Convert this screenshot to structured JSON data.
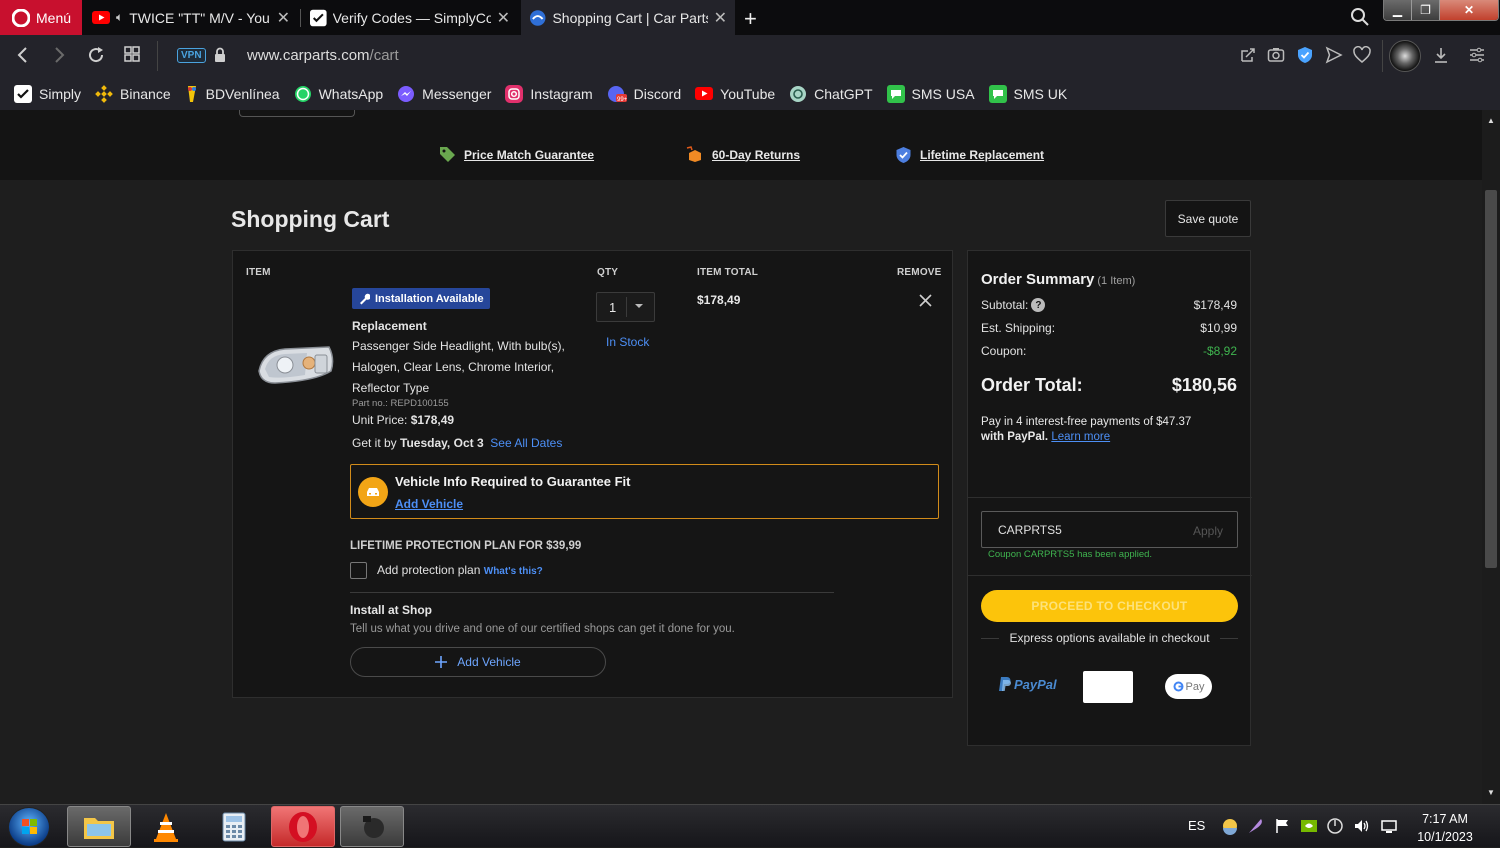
{
  "browser": {
    "menu_label": "Menú",
    "tabs": [
      {
        "title": "TWICE \"TT\" M/V - YouTube"
      },
      {
        "title": "Verify Codes — SimplyCodes"
      },
      {
        "title": "Shopping Cart | Car Parts"
      }
    ],
    "url_host": "www.carparts.com",
    "url_path": "/cart",
    "vpn_label": "VPN",
    "bookmarks": [
      {
        "label": "Simply",
        "icon": "simply-icon",
        "color": "#ffffff"
      },
      {
        "label": "Binance",
        "icon": "binance-icon",
        "color": "#f0b90b"
      },
      {
        "label": "BDVenlínea",
        "icon": "bdv-icon",
        "color": "#f2c40a"
      },
      {
        "label": "WhatsApp",
        "icon": "whatsapp-icon",
        "color": "#25d366"
      },
      {
        "label": "Messenger",
        "icon": "messenger-icon",
        "color": "#7b5cff"
      },
      {
        "label": "Instagram",
        "icon": "instagram-icon",
        "color": "#e1306c"
      },
      {
        "label": "Discord",
        "icon": "discord-icon",
        "color": "#5865f2"
      },
      {
        "label": "YouTube",
        "icon": "youtube-icon",
        "color": "#ff0000"
      },
      {
        "label": "ChatGPT",
        "icon": "chatgpt-icon",
        "color": "#a8d5c6"
      },
      {
        "label": "SMS USA",
        "icon": "sms-icon",
        "color": "#31c24a"
      },
      {
        "label": "SMS UK",
        "icon": "sms-icon",
        "color": "#31c24a"
      }
    ]
  },
  "guarantees": [
    {
      "label": "Price Match Guarantee",
      "icon": "tag-icon",
      "color": "#6aa84f"
    },
    {
      "label": "60-Day Returns",
      "icon": "box-icon",
      "color": "#f08a24"
    },
    {
      "label": "Lifetime Replacement",
      "icon": "shield-check-icon",
      "color": "#4d7fe0"
    }
  ],
  "cart": {
    "title": "Shopping Cart",
    "save_quote": "Save quote",
    "columns": {
      "item": "ITEM",
      "qty": "QTY",
      "item_total": "ITEM TOTAL",
      "remove": "REMOVE"
    },
    "item": {
      "badge": "Installation Available",
      "name": "Replacement",
      "desc_lines": [
        "Passenger Side Headlight, With bulb(s),",
        "Halogen, Clear Lens, Chrome Interior,",
        "Reflector Type"
      ],
      "part_no": "Part no.: REPD100155",
      "unit_price_label": "Unit Price: ",
      "unit_price": "$178,49",
      "eta_prefix": "Get it by ",
      "eta_date": "Tuesday, Oct 3",
      "see_dates": "See All Dates",
      "qty": "1",
      "stock": "In Stock",
      "total": "$178,49"
    },
    "vehicle": {
      "title": "Vehicle Info Required to Guarantee Fit",
      "link": "Add Vehicle"
    },
    "protection": {
      "title": "LIFETIME PROTECTION PLAN FOR $39,99",
      "label": "Add protection plan",
      "whats_this": "What's this?",
      "checked": false
    },
    "install": {
      "title": "Install at Shop",
      "desc": "Tell us what you drive and one of our certified shops can get it done for you.",
      "button": "Add Vehicle"
    }
  },
  "summary": {
    "title": "Order Summary",
    "count": "(1 Item)",
    "rows": [
      {
        "label": "Subtotal:",
        "value": "$178,49"
      },
      {
        "label": "Est. Shipping:",
        "value": "$10,99"
      },
      {
        "label": "Coupon:",
        "value": "-$8,92"
      }
    ],
    "order_total_label": "Order Total:",
    "order_total": "$180,56",
    "paypal_line1": "Pay in 4 interest-free payments of $47.37",
    "paypal_line2": "with PayPal.",
    "learn_more": "Learn more",
    "coupon_code": "CARPRTS5",
    "apply": "Apply",
    "coupon_msg": "Coupon CARPRTS5 has been applied.",
    "checkout": "PROCEED TO CHECKOUT",
    "express": "Express options available in checkout",
    "paypal_brand": "PayPal",
    "gpay": "Pay"
  },
  "taskbar": {
    "lang": "ES",
    "time": "7:17 AM",
    "date": "10/1/2023"
  }
}
